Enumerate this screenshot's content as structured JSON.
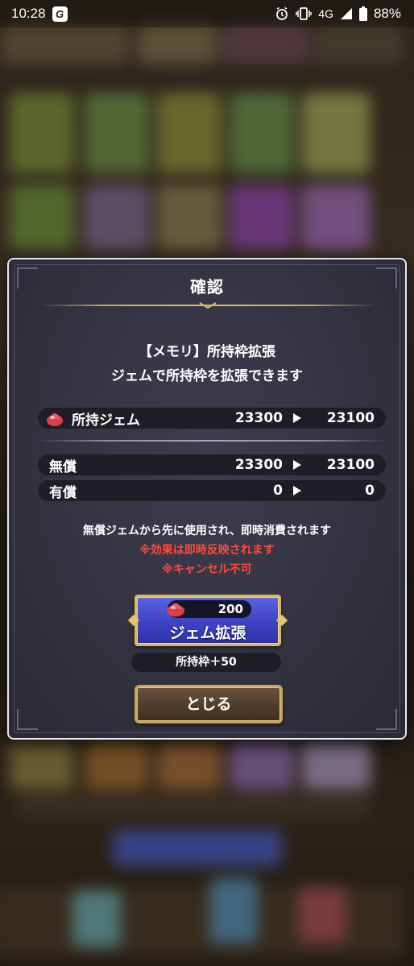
{
  "status_bar": {
    "time": "10:28",
    "network": "4G",
    "battery": "88%"
  },
  "dialog": {
    "title": "確認",
    "message_line1": "【メモリ】所持枠拡張",
    "message_line2": "ジェムで所持枠を拡張できます",
    "rows": {
      "owned_gems": {
        "label": "所持ジェム",
        "from": "23300",
        "to": "23100"
      },
      "free": {
        "label": "無償",
        "from": "23300",
        "to": "23100"
      },
      "paid": {
        "label": "有償",
        "from": "0",
        "to": "0"
      }
    },
    "notes": {
      "line1": "無償ジェムから先に使用され、即時消費されます",
      "line2": "※効果は即時反映されます",
      "line3": "※キャンセル不可"
    },
    "expand_button": {
      "cost": "200",
      "label": "ジェム拡張"
    },
    "expand_effect": "所持枠＋50",
    "close_button_label": "とじる"
  },
  "colors": {
    "warning_text": "#ff4a3a",
    "expand_button": "#3d43c4",
    "gold_frame": "#d8b860",
    "dialog_bg": "#32323f"
  },
  "icons": {
    "app_badge": "g-app-icon",
    "alarm": "alarm-icon",
    "vibrate": "vibrate-icon",
    "signal": "signal-icon",
    "battery": "battery-icon",
    "gem": "red-gem-icon"
  }
}
